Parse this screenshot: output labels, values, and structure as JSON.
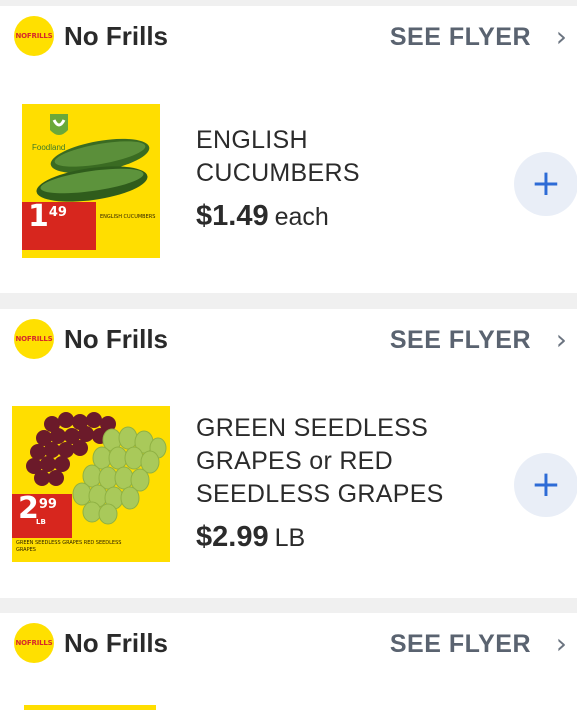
{
  "cards": [
    {
      "store": {
        "name": "No Frills",
        "logo_text": "NOFRILLS"
      },
      "see_flyer": "SEE FLYER",
      "product": {
        "name_lines": [
          "ENGLISH",
          "CUCUMBERS"
        ],
        "price": "$1.49",
        "unit": "each",
        "image": {
          "brand": "Foodland",
          "tag_price_main": "1",
          "tag_price_cents": "49",
          "fine_print": "ENGLISH CUCUMBERS"
        }
      }
    },
    {
      "store": {
        "name": "No Frills",
        "logo_text": "NOFRILLS"
      },
      "see_flyer": "SEE FLYER",
      "product": {
        "name_lines": [
          "GREEN SEEDLESS",
          "GRAPES or RED",
          "SEEDLESS GRAPES"
        ],
        "price": "$2.99",
        "unit": "LB",
        "image": {
          "tag_price_main": "2",
          "tag_price_cents": "99",
          "tag_unit": "LB",
          "fine_print": "GREEN SEEDLESS GRAPES RED SEEDLESS GRAPES"
        }
      }
    },
    {
      "store": {
        "name": "No Frills",
        "logo_text": "NOFRILLS"
      },
      "see_flyer": "SEE FLYER"
    }
  ],
  "icons": {
    "add": "plus-icon",
    "chevron": "chevron-right-icon"
  },
  "colors": {
    "accent_blue": "#2d6bd6",
    "logo_yellow": "#ffe000",
    "tag_red": "#d7261e"
  }
}
